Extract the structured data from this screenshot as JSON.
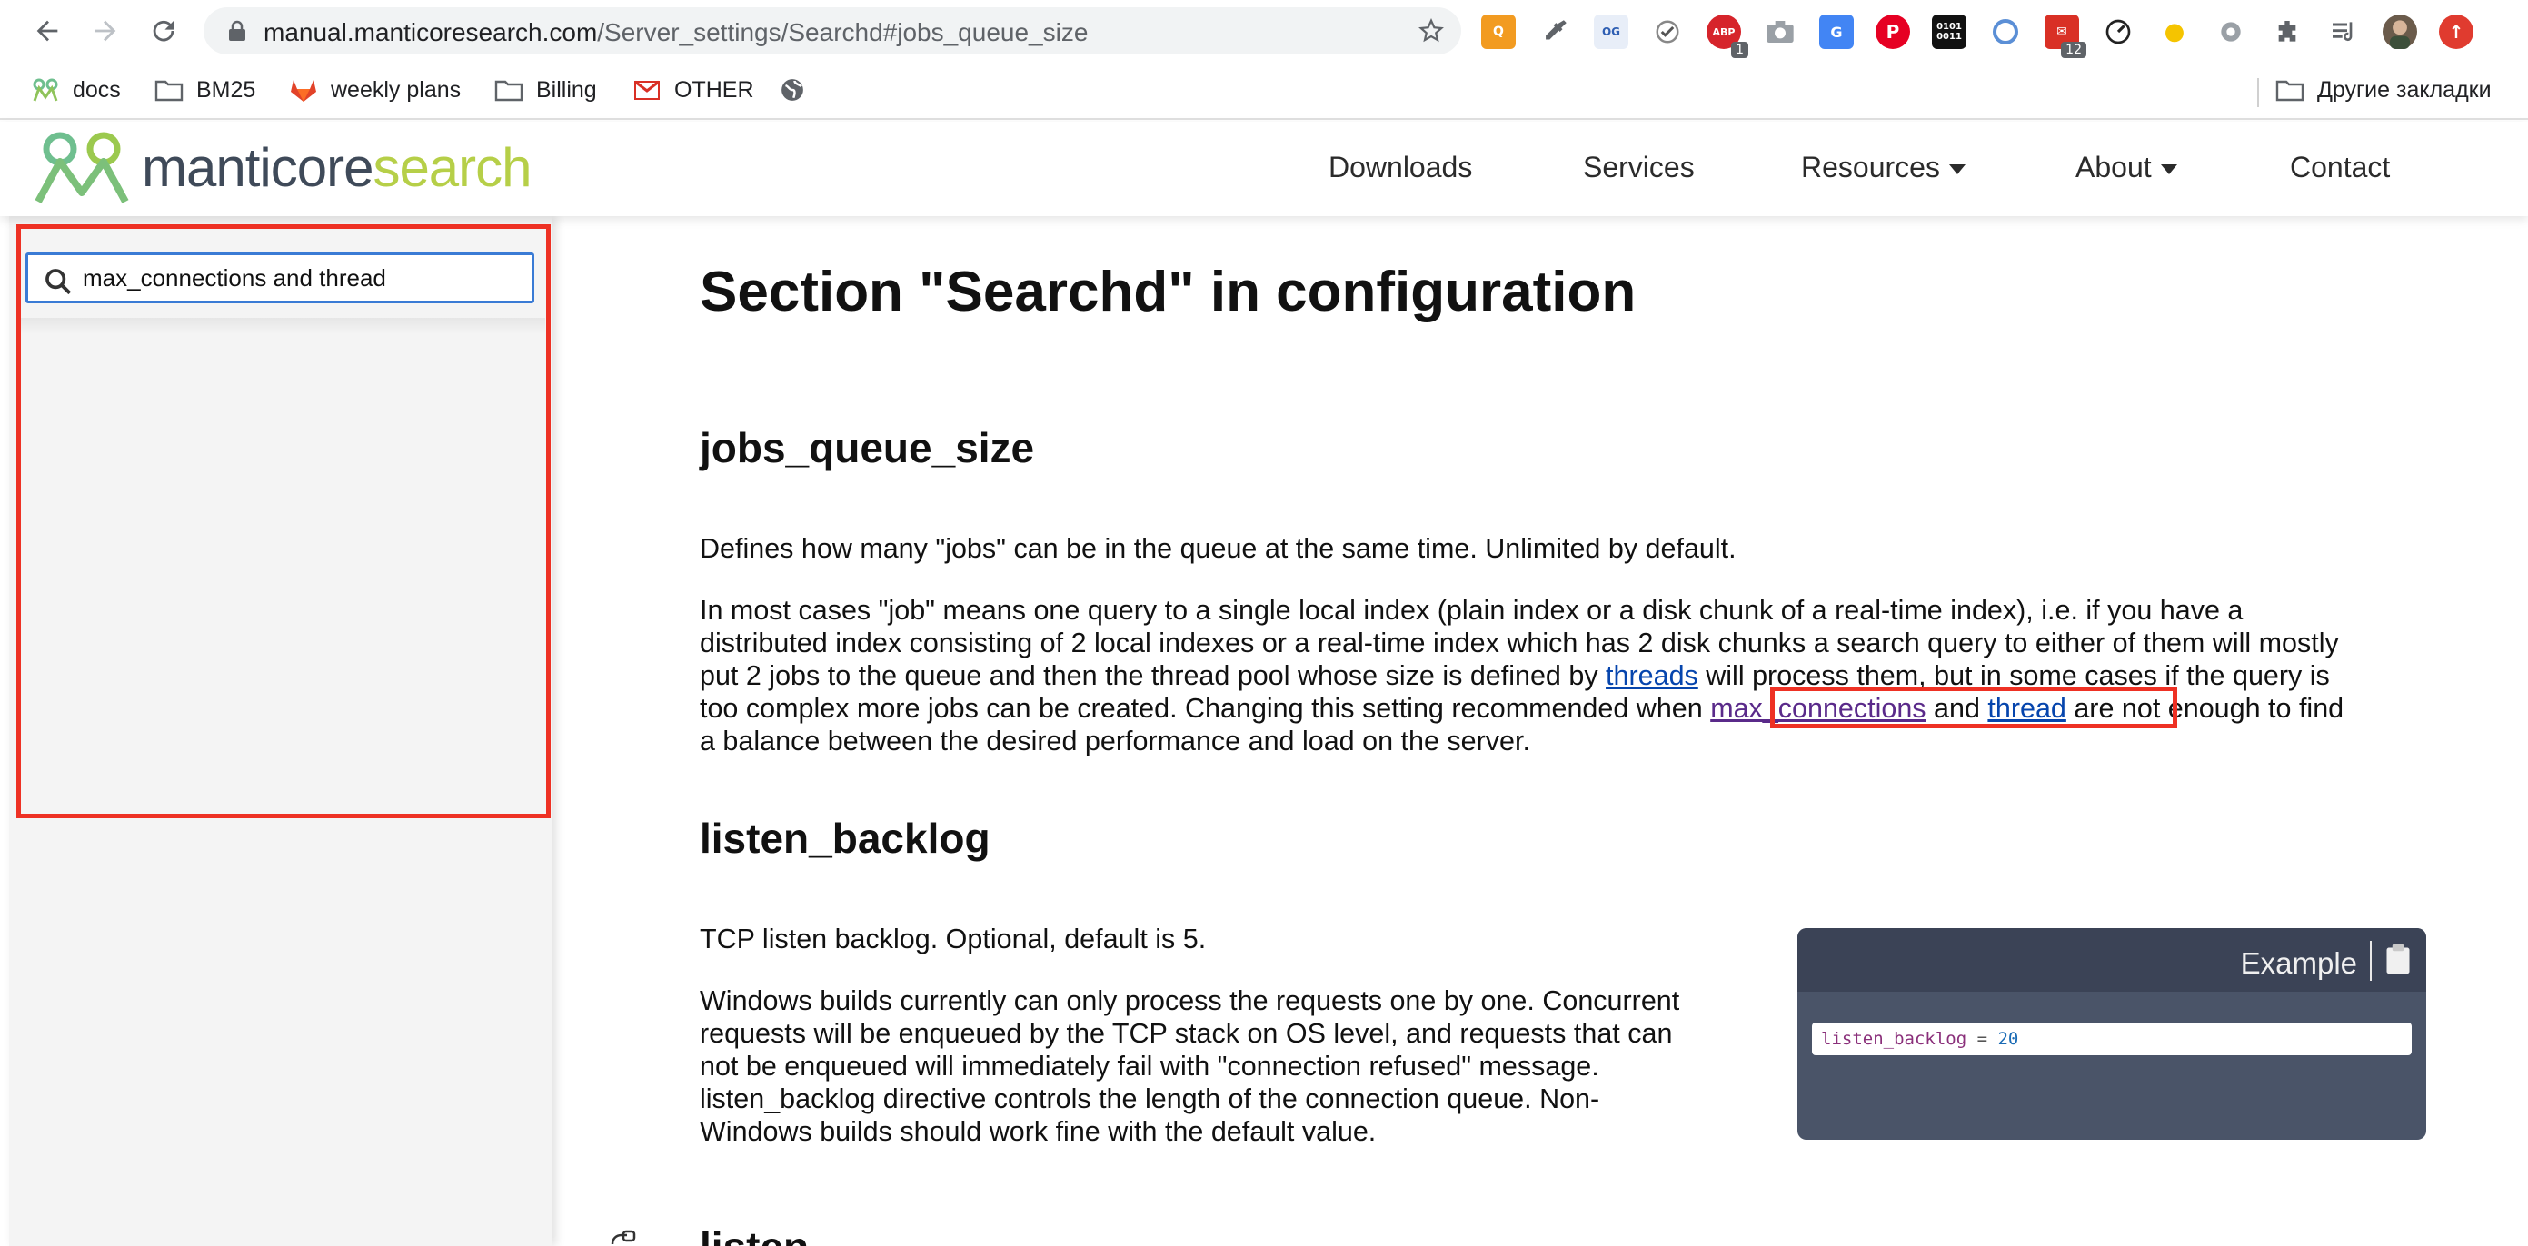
{
  "browser": {
    "url_host": "manual.manticoresearch.com",
    "url_path": "/Server_settings/Searchd#jobs_queue_size",
    "extension_badges": {
      "abp": "1",
      "gmail": "12"
    },
    "bookmarks": [
      {
        "label": "docs"
      },
      {
        "label": "BM25"
      },
      {
        "label": "weekly plans"
      },
      {
        "label": "Billing"
      },
      {
        "label": "OTHER"
      }
    ],
    "other_bookmarks": "Другие закладки"
  },
  "site": {
    "logo_part1": "manticore",
    "logo_part2": "search",
    "nav": {
      "downloads": "Downloads",
      "services": "Services",
      "resources": "Resources",
      "about": "About",
      "contact": "Contact"
    },
    "colors": {
      "logo_dark": "#3f4a59",
      "logo_green": "#b6cf48",
      "highlight": "#ee3124"
    }
  },
  "sidebar": {
    "search_value": "max_connections and thread"
  },
  "main": {
    "title": "Section \"Searchd\" in configuration",
    "jobs": {
      "heading": "jobs_queue_size",
      "p1": "Defines how many \"jobs\" can be in the queue at the same time. Unlimited by default.",
      "p2_l1": "In most cases \"job\" means one query to a single local index (plain index or a disk chunk of a real-time index), i.e. if you have a",
      "p2_l2": "distributed index consisting of 2 local indexes or a real-time index which has 2 disk chunks a search query to either of them will mostly",
      "p2_l3_a": "put 2 jobs to the queue and then the thread pool whose size is defined by ",
      "p2_l3_link": "threads",
      "p2_l3_b": " will process them, but in some cases if the query is",
      "p2_l4_a": "too complex more jobs can be created. Changing this setting recommended when ",
      "p2_l4_link1": "max_connections",
      "p2_l4_mid": " and ",
      "p2_l4_link2": "thread",
      "p2_l4_b": " are not enough to find",
      "p2_l5": "a balance between the desired performance and load on the server."
    },
    "backlog": {
      "heading": "listen_backlog",
      "p1": "TCP listen backlog. Optional, default is 5.",
      "p2_l1": "Windows builds currently can only process the requests one by one. Concurrent",
      "p2_l2": "requests will be enqueued by the TCP stack on OS level, and requests that can",
      "p2_l3": "not be enqueued will immediately fail with \"connection refused\" message.",
      "p2_l4": "listen_backlog directive controls the length of the connection queue. Non-",
      "p2_l5": "Windows builds should work fine with the default value."
    },
    "next_heading": "listen",
    "example": {
      "label": "Example",
      "code_key": "listen_backlog",
      "code_op": " = ",
      "code_val": "20"
    }
  }
}
